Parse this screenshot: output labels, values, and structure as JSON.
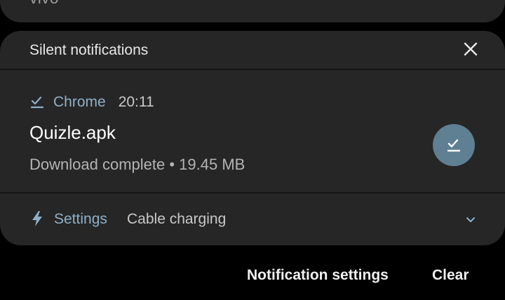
{
  "top_card": {
    "partial_text": "vivo"
  },
  "silent_section": {
    "title": "Silent notifications",
    "close_icon": "close-icon"
  },
  "notification": {
    "app_icon": "download-done-icon",
    "app_name": "Chrome",
    "time": "20:11",
    "title": "Quizle.apk",
    "text": "Download complete • 19.45 MB",
    "action_icon": "download-done-icon",
    "action_color": "#5f7f93"
  },
  "settings_row": {
    "icon": "lightning-bolt-icon",
    "label": "Settings",
    "status": "Cable charging",
    "expand_icon": "chevron-down-icon"
  },
  "footer": {
    "notification_settings": "Notification settings",
    "clear": "Clear"
  },
  "colors": {
    "background": "#000000",
    "card": "#262626",
    "accent": "#8fb0c8"
  }
}
